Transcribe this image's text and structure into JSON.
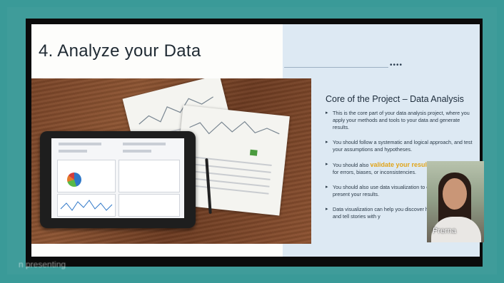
{
  "slide": {
    "title": "4. Analyze your Data",
    "dots": "••••",
    "core_title": "Core of the Project – Data Analysis",
    "bullets": [
      "This is the core part of your data analysis project, where you apply your methods and tools to your data and generate results.",
      "You should follow a systematic and logical approach, and test your assumptions and hypotheses.",
      "for errors, biases, or inconsistencies.",
      "You should also use data visualization to e communicate, and present your results.",
      "Data visualization can help you discover highlight patterns, and tell stories with y"
    ],
    "bullet3_prefix": "You should also ",
    "bullet3_highlight": "validate your resul"
  },
  "participant": {
    "name": "Prerna"
  },
  "status": {
    "presenting": "n presenting"
  },
  "colors": {
    "frame": "#3a9a98",
    "highlight": "#e0a41a",
    "slide_right_bg": "#dde9f3"
  }
}
